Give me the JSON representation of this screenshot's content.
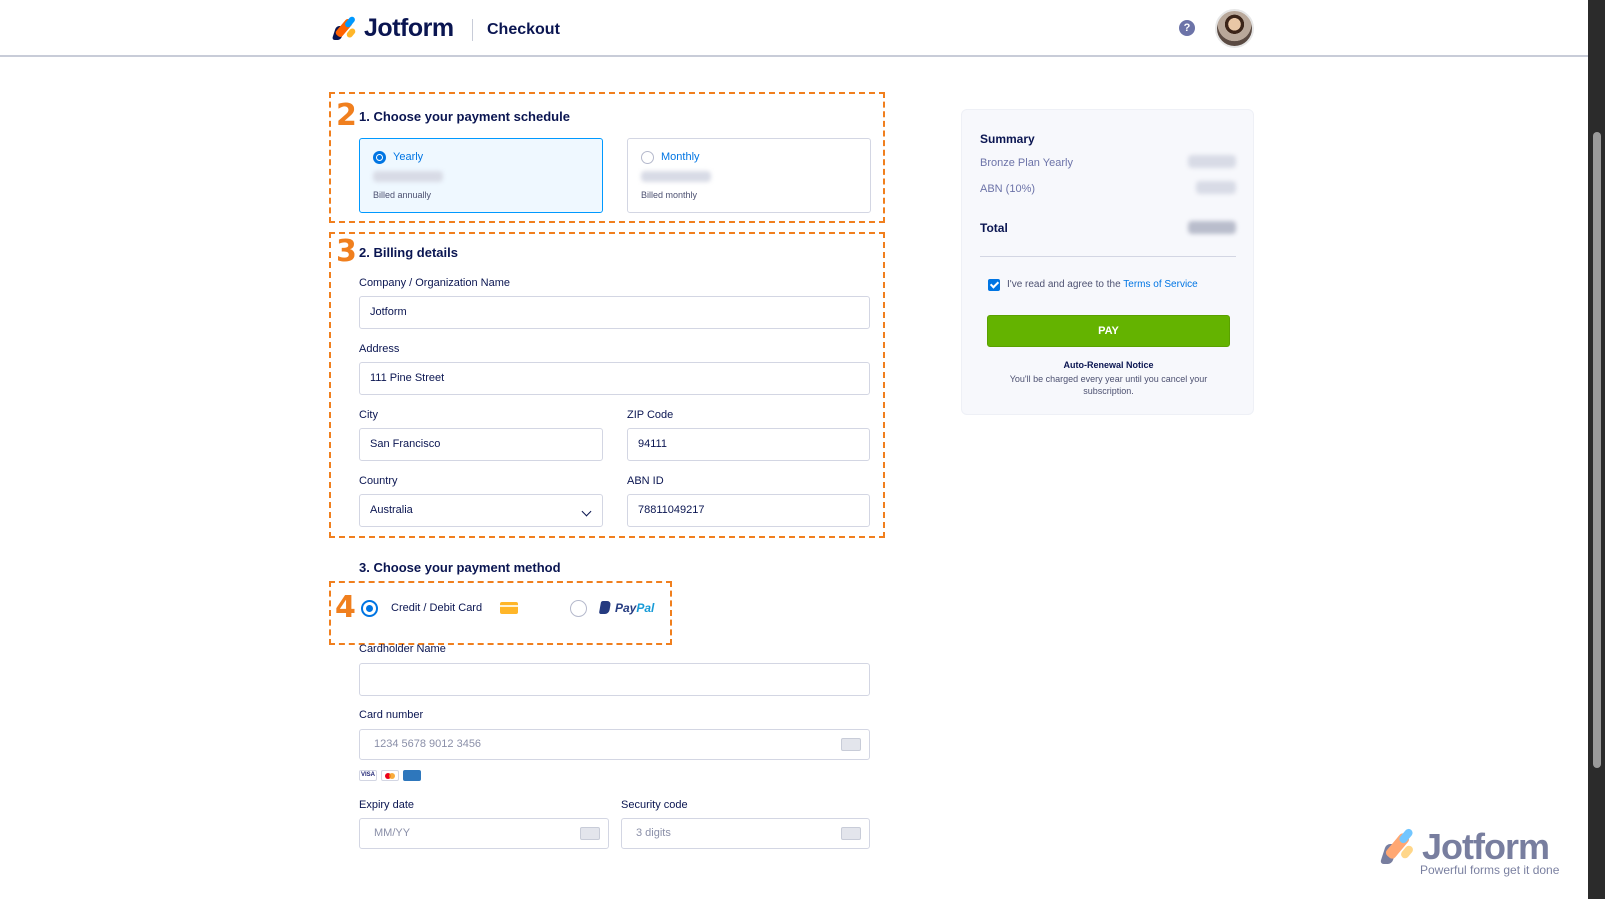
{
  "header": {
    "logo_text": "Jotform",
    "page_title": "Checkout",
    "help_label": "?"
  },
  "annotations": [
    "2",
    "3",
    "4"
  ],
  "schedule": {
    "title": "1. Choose your payment schedule",
    "options": [
      {
        "name": "Yearly",
        "note": "Billed annually",
        "selected": true
      },
      {
        "name": "Monthly",
        "note": "Billed monthly",
        "selected": false
      }
    ]
  },
  "billing": {
    "title": "2. Billing details",
    "company_label": "Company / Organization Name",
    "company_value": "Jotform",
    "address_label": "Address",
    "address_value": "111 Pine Street",
    "city_label": "City",
    "city_value": "San Francisco",
    "zip_label": "ZIP Code",
    "zip_value": "94111",
    "country_label": "Country",
    "country_value": "Australia",
    "abn_label": "ABN ID",
    "abn_value": "78811049217"
  },
  "payment": {
    "title": "3. Choose your payment method",
    "card_option": "Credit / Debit Card",
    "paypal_pay": "Pay",
    "paypal_pal": "Pal",
    "cardholder_label": "Cardholder Name",
    "cardholder_value": "",
    "card_number_label": "Card number",
    "card_number_placeholder": "1234 5678 9012 3456",
    "card_brands": [
      "VISA",
      "mastercard",
      "amex"
    ],
    "expiry_label": "Expiry date",
    "expiry_placeholder": "MM/YY",
    "security_label": "Security code",
    "security_placeholder": "3 digits"
  },
  "summary": {
    "title": "Summary",
    "plan_line": "Bronze Plan Yearly",
    "tax_line": "ABN (10%)",
    "total_label": "Total",
    "agree_text": "I've read and agree to the ",
    "tos_link": "Terms of Service",
    "pay_button": "PAY",
    "notice_title": "Auto-Renewal Notice",
    "notice_text": "You'll be charged every year until you cancel your subscription."
  },
  "watermark": {
    "text": "Jotform",
    "tagline": "Powerful forms get it done"
  },
  "colors": {
    "accent": "#0075e3",
    "annotation": "#f07f1e",
    "pay_button": "#64b300",
    "navy": "#0a1551"
  }
}
